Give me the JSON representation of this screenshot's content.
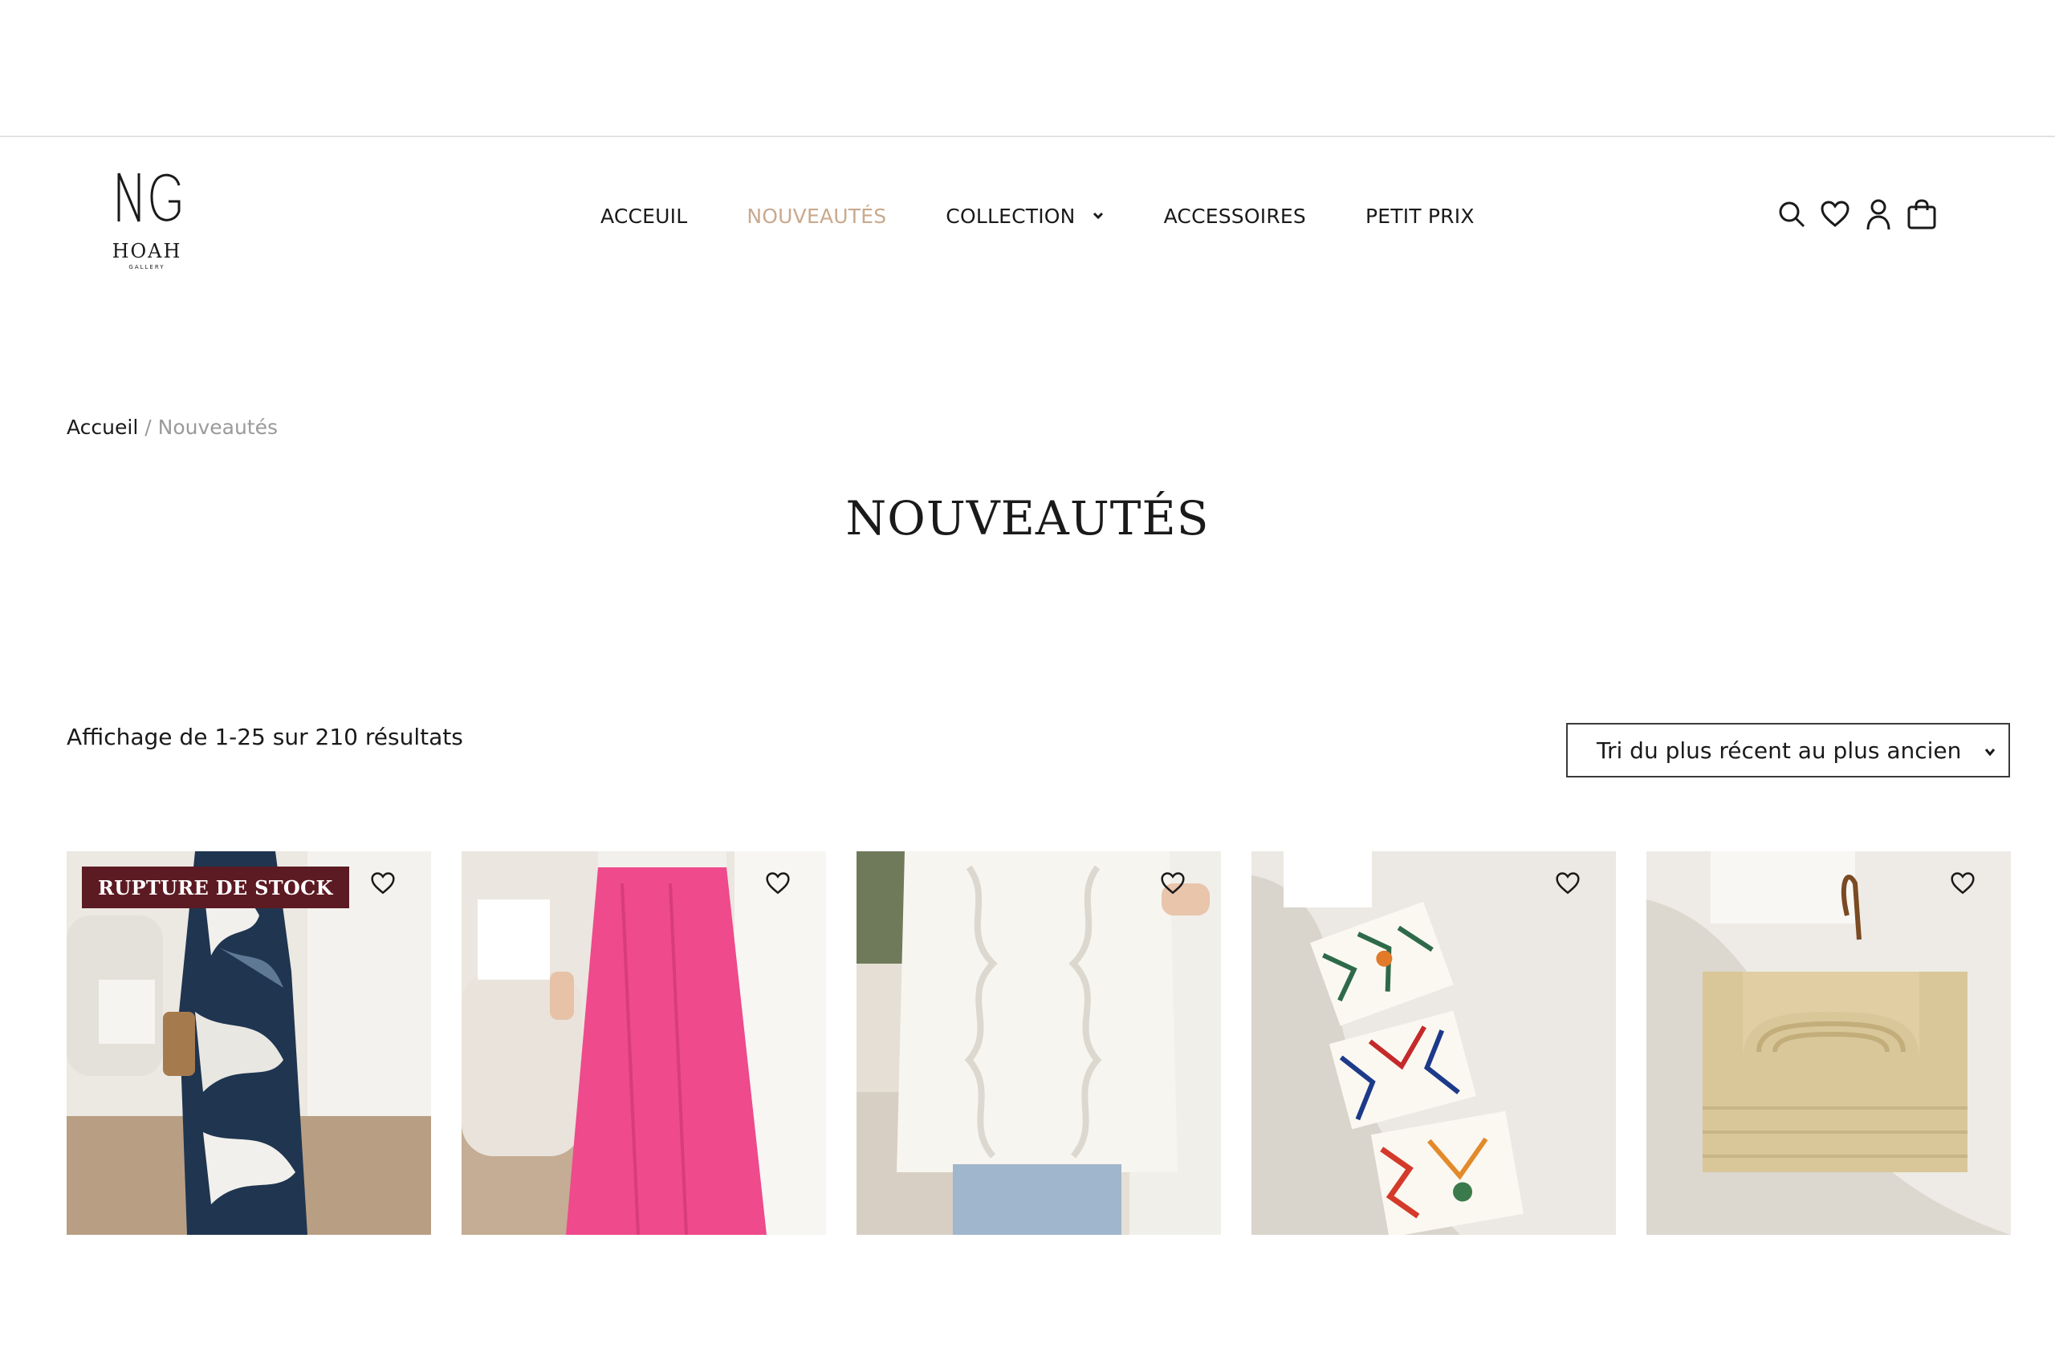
{
  "logo": {
    "text": "HOAH",
    "subtext": "GALLERY"
  },
  "nav": {
    "items": [
      {
        "label": "ACCEUIL"
      },
      {
        "label": "NOUVEAUTÉS"
      },
      {
        "label": "COLLECTION"
      },
      {
        "label": "ACCESSOIRES"
      },
      {
        "label": "PETIT PRIX"
      }
    ],
    "active_color": "#c9a98e"
  },
  "header_icons": [
    "search-icon",
    "heart-icon",
    "user-icon",
    "bag-icon"
  ],
  "breadcrumb": {
    "home": "Accueil",
    "separator": "/",
    "current": "Nouveautés"
  },
  "page_title": "NOUVEAUTÉS",
  "results_text": "Affichage de 1-25 sur 210 résultats",
  "sort": {
    "selected": "Tri du plus récent au plus ancien"
  },
  "products": [
    {
      "badge": "RUPTURE DE STOCK",
      "badge_color": "#5c1a23"
    },
    {
      "badge": null
    },
    {
      "badge": null
    },
    {
      "badge": null
    },
    {
      "badge": null
    }
  ]
}
